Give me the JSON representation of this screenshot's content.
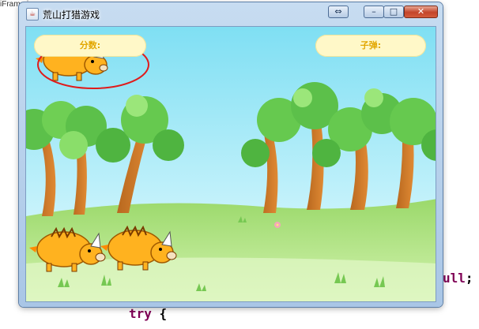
{
  "editor": {
    "tab_label": "iFrame.java",
    "tab_close": "✕",
    "code_tail_keyword": "ull",
    "code_tail_semicolon": ";",
    "code_bottom_keyword": "try",
    "code_bottom_brace": "{"
  },
  "window": {
    "title": "荒山打猎游戏",
    "app_icon": "java-icon",
    "buttons": {
      "restore_extra": "⇔",
      "minimize": "–",
      "maximize": "□",
      "close": "✕"
    }
  },
  "hud": {
    "score_label": "分数:",
    "bullets_label": "子弹:"
  },
  "scene": {
    "sky_top": "#8be3f5",
    "sky_bottom": "#e8fbff",
    "grass_color": "#8fd46a",
    "boar_color": "#ffb21f",
    "target_ring_color": "#e01b1b"
  }
}
